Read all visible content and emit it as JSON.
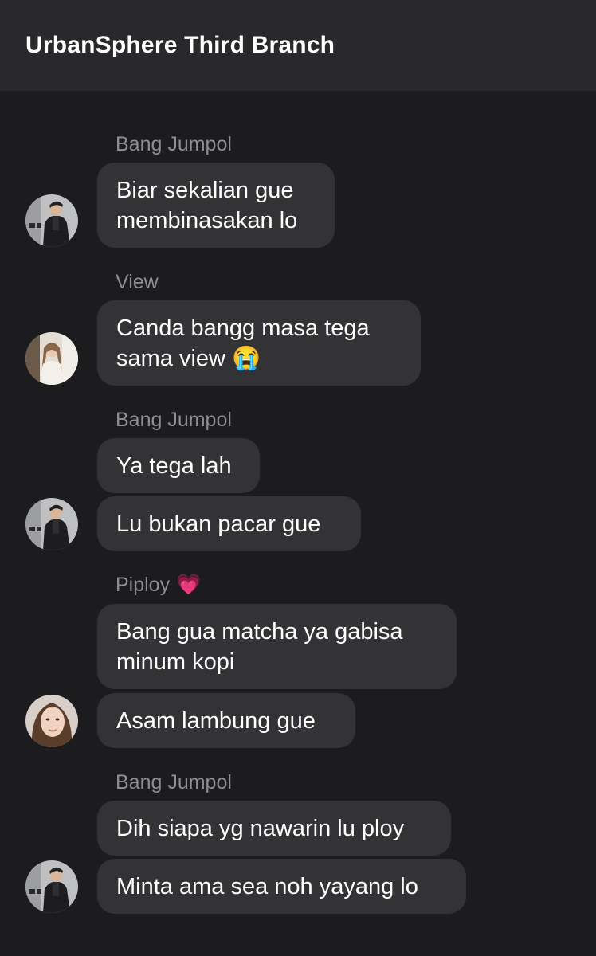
{
  "header": {
    "title": "UrbanSphere Third Branch"
  },
  "groups": [
    {
      "sender": "Bang Jumpol",
      "avatar": "male-avatar",
      "messages": [
        "Biar sekalian gue\nmembinasakan lo"
      ]
    },
    {
      "sender": "View",
      "avatar": "female-avatar-light",
      "messages": [
        "Canda bangg masa tega\nsama view 😭"
      ]
    },
    {
      "sender": "Bang Jumpol",
      "avatar": "male-avatar",
      "messages": [
        "Ya tega lah",
        "Lu bukan pacar gue"
      ]
    },
    {
      "sender": "Piploy",
      "sender_emoji": "💗",
      "avatar": "female-avatar-selfie",
      "messages": [
        "Bang gua matcha ya gabisa\nminum kopi",
        "Asam lambung gue"
      ]
    },
    {
      "sender": "Bang Jumpol",
      "avatar": "male-avatar",
      "messages": [
        "Dih siapa yg nawarin lu ploy",
        "Minta ama sea noh yayang lo"
      ]
    }
  ],
  "colors": {
    "background": "#1c1c1e",
    "header": "#29292b",
    "bubble": "#333336",
    "sender_text": "#8e8e93",
    "message_text": "#ffffff"
  }
}
